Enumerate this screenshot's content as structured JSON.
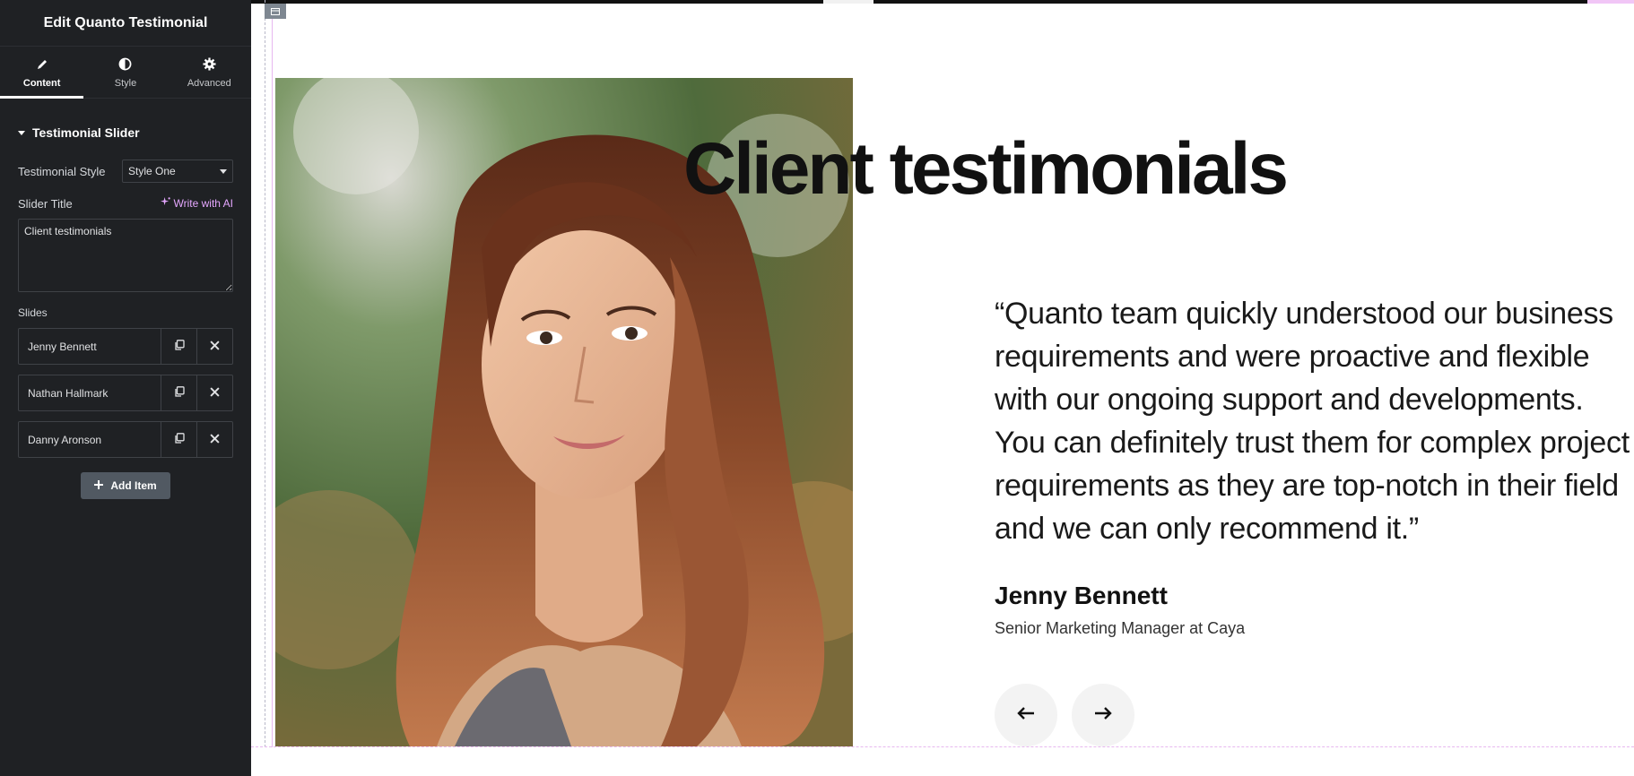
{
  "panel": {
    "title": "Edit Quanto Testimonial",
    "tabs": [
      {
        "label": "Content",
        "icon": "pencil-icon"
      },
      {
        "label": "Style",
        "icon": "contrast-icon"
      },
      {
        "label": "Advanced",
        "icon": "gear-icon"
      }
    ],
    "section_title": "Testimonial Slider",
    "testimonial_style": {
      "label": "Testimonial Style",
      "value": "Style One"
    },
    "slider_title": {
      "label": "Slider Title",
      "value": "Client testimonials",
      "ai_label": "Write with AI"
    },
    "slides_label": "Slides",
    "slides": [
      {
        "name": "Jenny Bennett"
      },
      {
        "name": "Nathan Hallmark"
      },
      {
        "name": "Danny Aronson"
      }
    ],
    "add_item_label": "Add Item"
  },
  "preview": {
    "heading": "Client testimonials",
    "quote": "“Quanto team quickly understood our business requirements and were proactive and flexible with our ongoing support and developments. You can definitely trust them for complex project requirements as they are top-notch in their field and we can only recommend it.”",
    "author_name": "Jenny Bennett",
    "author_role": "Senior Marketing Manager at Caya",
    "prev_icon": "arrow-left-icon",
    "next_icon": "arrow-right-icon"
  },
  "colors": {
    "panel_bg": "#1f2124",
    "ai_accent": "#e5a7ff",
    "add_button_bg": "#515962",
    "nav_button_bg": "#f3f3f3",
    "guide_pink": "#e7b8ef"
  }
}
